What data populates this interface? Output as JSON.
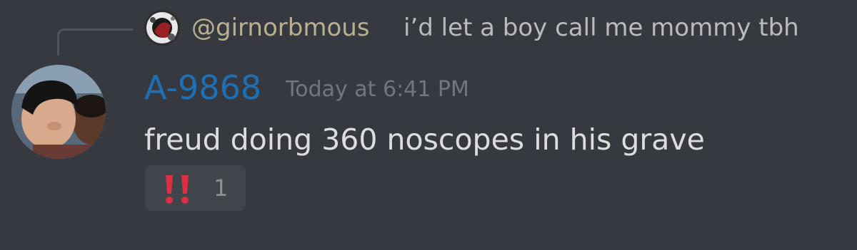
{
  "reply": {
    "author": "@girnorbmous",
    "text": "i’d let a boy call me mommy tbh"
  },
  "message": {
    "author": "A-9868",
    "timestamp": "Today at 6:41 PM",
    "content": "freud doing 360 noscopes in his grave",
    "reactions": [
      {
        "emoji": "double-exclamation-icon",
        "count": "1"
      }
    ]
  },
  "colors": {
    "background": "#36393f",
    "reply_author": "#b8b08f",
    "author": "#1f6fb5",
    "timestamp": "#72767d",
    "content": "#dcddde",
    "reaction_bg": "#40444b",
    "reaction_emoji": "#dd2e44"
  }
}
